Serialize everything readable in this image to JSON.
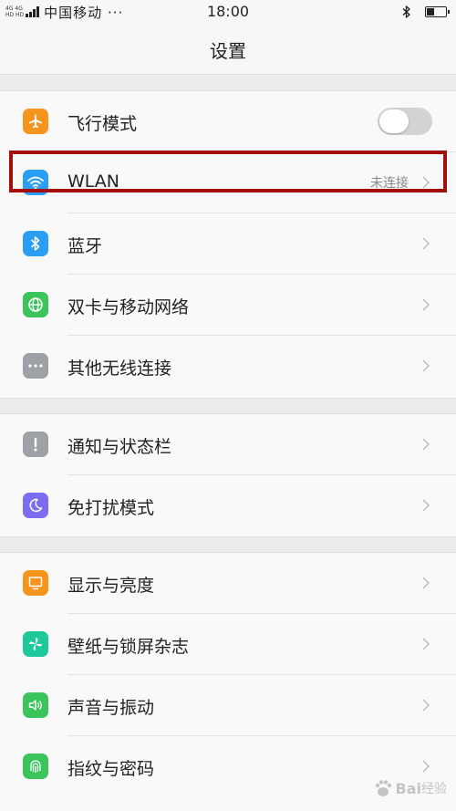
{
  "status_bar": {
    "network_top": "4G 4G",
    "network_bottom": "HD HD",
    "carrier": "中国移动 ···",
    "time": "18:00",
    "battery_level": 0.4
  },
  "header": {
    "title": "设置"
  },
  "groups": [
    {
      "items": [
        {
          "label": "飞行模式",
          "icon": "airplane-icon",
          "icon_color": "#f7941d",
          "control": "toggle",
          "toggle_on": false
        },
        {
          "label": "WLAN",
          "icon": "wifi-icon",
          "icon_color": "#2a9df4",
          "value": "未连接",
          "control": "chevron",
          "highlighted": true
        },
        {
          "label": "蓝牙",
          "icon": "bluetooth-icon",
          "icon_color": "#2a9df4",
          "control": "chevron"
        },
        {
          "label": "双卡与移动网络",
          "icon": "globe-icon",
          "icon_color": "#3cc45c",
          "control": "chevron"
        },
        {
          "label": "其他无线连接",
          "icon": "more-dots-icon",
          "icon_color": "#9ea1a6",
          "control": "chevron"
        }
      ]
    },
    {
      "items": [
        {
          "label": "通知与状态栏",
          "icon": "notification-icon",
          "icon_color": "#9ea1a6",
          "control": "chevron"
        },
        {
          "label": "免打扰模式",
          "icon": "moon-icon",
          "icon_color": "#7b6cf0",
          "control": "chevron"
        }
      ]
    },
    {
      "items": [
        {
          "label": "显示与亮度",
          "icon": "display-icon",
          "icon_color": "#f7941d",
          "control": "chevron"
        },
        {
          "label": "壁纸与锁屏杂志",
          "icon": "pinwheel-icon",
          "icon_color": "#1dc99a",
          "control": "chevron"
        },
        {
          "label": "声音与振动",
          "icon": "speaker-icon",
          "icon_color": "#3cc45c",
          "control": "chevron"
        },
        {
          "label": "指纹与密码",
          "icon": "fingerprint-icon",
          "icon_color": "#3cc45c",
          "control": "chevron"
        }
      ]
    }
  ],
  "watermark": {
    "brand": "Bai",
    "suffix": "经验"
  }
}
